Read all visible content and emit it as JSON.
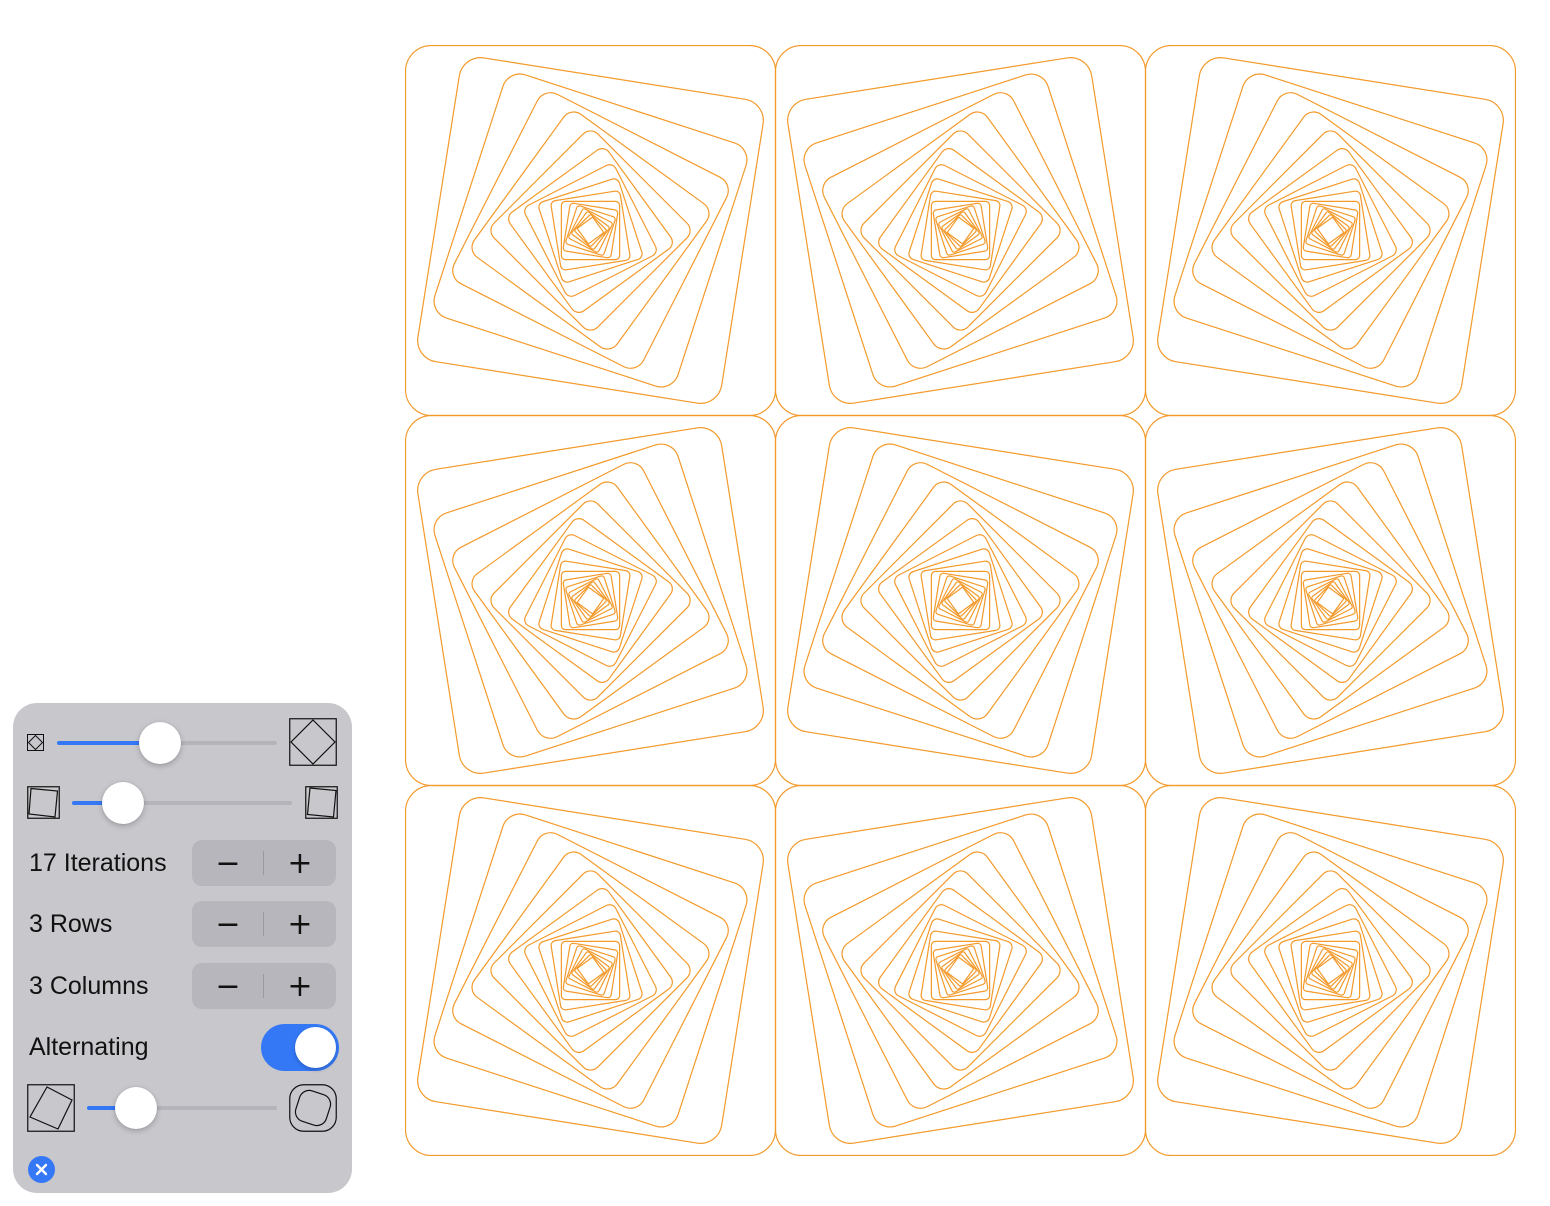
{
  "canvas": {
    "rows": 3,
    "columns": 3,
    "iterations": 17,
    "alternating": true,
    "stroke_color": "#f39a2b",
    "rotation_per_step_deg": 9,
    "shrink_per_step": 0.86
  },
  "controls": {
    "accent_color": "#3478f6",
    "inset_slider": {
      "min_icon": "small-rotated-square-icon",
      "max_icon": "large-rotated-square-icon",
      "value": 0.47
    },
    "rotation_slider": {
      "min_icon": "tilted-square-left-icon",
      "max_icon": "tilted-square-right-icon",
      "value": 0.23
    },
    "iterations": {
      "label": "17 Iterations",
      "minus": "−",
      "plus": "+"
    },
    "rows": {
      "label": "3 Rows",
      "minus": "−",
      "plus": "+"
    },
    "columns": {
      "label": "3 Columns",
      "minus": "−",
      "plus": "+"
    },
    "alternating": {
      "label": "Alternating",
      "on": true
    },
    "corner_slider": {
      "min_icon": "sharp-corner-square-icon",
      "max_icon": "rounded-corner-square-icon",
      "value": 0.26
    },
    "close_icon": "close-icon"
  }
}
